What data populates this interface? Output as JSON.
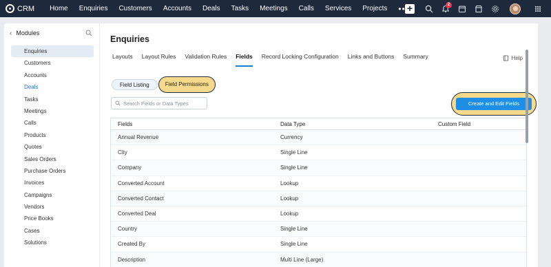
{
  "topbar": {
    "app_name": "CRM",
    "nav": [
      "Home",
      "Enquiries",
      "Customers",
      "Accounts",
      "Deals",
      "Tasks",
      "Meetings",
      "Calls",
      "Services",
      "Projects"
    ],
    "more": "•••",
    "notification_count": "2"
  },
  "sidebar": {
    "title": "Modules",
    "items": [
      "Enquiries",
      "Customers",
      "Accounts",
      "Deals",
      "Tasks",
      "Meetings",
      "Calls",
      "Products",
      "Quotes",
      "Sales Orders",
      "Purchase Orders",
      "Invoices",
      "Campaigns",
      "Vendors",
      "Price Books",
      "Cases",
      "Solutions"
    ]
  },
  "main": {
    "title": "Enquiries",
    "tabs": [
      "Layouts",
      "Layout Rules",
      "Validation Rules",
      "Fields",
      "Record Locking Configuration",
      "Links and Buttons",
      "Summary"
    ],
    "help": "Help",
    "segments": [
      "Field Listing",
      "Field Permissions"
    ],
    "search_placeholder": "Search Fields or Data Types",
    "create_button": "Create and Edit Fields",
    "table": {
      "headers": [
        "Fields",
        "Data Type",
        "Custom Field"
      ],
      "rows": [
        [
          "Annual Revenue",
          "Currency"
        ],
        [
          "City",
          "Single Line"
        ],
        [
          "Company",
          "Single Line"
        ],
        [
          "Converted Account",
          "Lookup"
        ],
        [
          "Converted Contact",
          "Lookup"
        ],
        [
          "Converted Deal",
          "Lookup"
        ],
        [
          "Country",
          "Single Line"
        ],
        [
          "Created By",
          "Single Line"
        ],
        [
          "Description",
          "Multi Line (Large)"
        ]
      ]
    }
  }
}
